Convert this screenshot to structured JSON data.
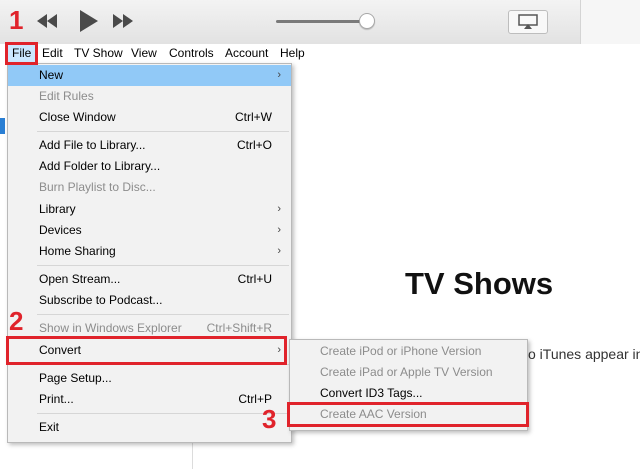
{
  "toolbar": {
    "icons": [
      "rewind-icon",
      "play-icon",
      "fast-forward-icon",
      "volume-slider",
      "airplay-icon"
    ]
  },
  "menubar": {
    "items": [
      "File",
      "Edit",
      "TV Show",
      "View",
      "Controls",
      "Account",
      "Help"
    ]
  },
  "file_menu": {
    "items": [
      {
        "label": "New",
        "shortcut": "",
        "submenu": true,
        "enabled": true
      },
      {
        "label": "Edit Rules",
        "shortcut": "",
        "submenu": false,
        "enabled": false
      },
      {
        "label": "Close Window",
        "shortcut": "Ctrl+W",
        "submenu": false,
        "enabled": true
      },
      {
        "label": "Add File to Library...",
        "shortcut": "Ctrl+O",
        "submenu": false,
        "enabled": true
      },
      {
        "label": "Add Folder to Library...",
        "shortcut": "",
        "submenu": false,
        "enabled": true
      },
      {
        "label": "Burn Playlist to Disc...",
        "shortcut": "",
        "submenu": false,
        "enabled": false
      },
      {
        "label": "Library",
        "shortcut": "",
        "submenu": true,
        "enabled": true
      },
      {
        "label": "Devices",
        "shortcut": "",
        "submenu": true,
        "enabled": true
      },
      {
        "label": "Home Sharing",
        "shortcut": "",
        "submenu": true,
        "enabled": true
      },
      {
        "label": "Open Stream...",
        "shortcut": "Ctrl+U",
        "submenu": false,
        "enabled": true
      },
      {
        "label": "Subscribe to Podcast...",
        "shortcut": "",
        "submenu": false,
        "enabled": true
      },
      {
        "label": "Show in Windows Explorer",
        "shortcut": "Ctrl+Shift+R",
        "submenu": false,
        "enabled": false
      },
      {
        "label": "Convert",
        "shortcut": "",
        "submenu": true,
        "enabled": true
      },
      {
        "label": "Page Setup...",
        "shortcut": "",
        "submenu": false,
        "enabled": true
      },
      {
        "label": "Print...",
        "shortcut": "Ctrl+P",
        "submenu": false,
        "enabled": true
      },
      {
        "label": "Exit",
        "shortcut": "",
        "submenu": false,
        "enabled": true
      }
    ]
  },
  "convert_submenu": {
    "items": [
      {
        "label": "Create iPod or iPhone Version",
        "enabled": false
      },
      {
        "label": "Create iPad or Apple TV Version",
        "enabled": false
      },
      {
        "label": "Convert ID3 Tags...",
        "enabled": true
      },
      {
        "label": "Create AAC Version",
        "enabled": false
      }
    ]
  },
  "content": {
    "title": "TV Shows",
    "description_fragment": "o iTunes appear in"
  },
  "annotations": {
    "step1": "1",
    "step2": "2",
    "step3": "3",
    "color": "#e0232b"
  },
  "colors": {
    "highlight": "#91c9f7",
    "menu_bg": "#f2f2f2",
    "disabled_text": "#8c8c8c"
  }
}
